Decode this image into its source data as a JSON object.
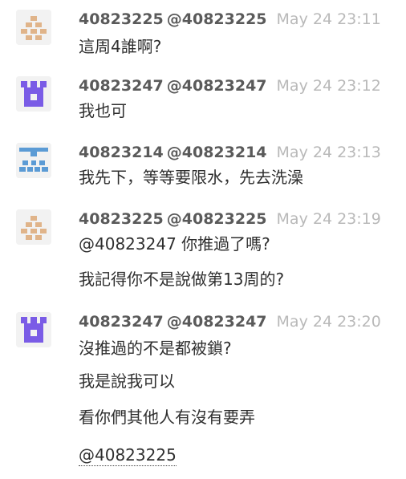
{
  "messages": [
    {
      "user": "40823225",
      "handle": "@40823225",
      "time": "May 24 23:11",
      "avatar_icon": "identicon-orange",
      "avatar_color": "#e0b48a",
      "lines": [
        "這周4誰啊?"
      ]
    },
    {
      "user": "40823247",
      "handle": "@40823247",
      "time": "May 24 23:12",
      "avatar_icon": "identicon-purple",
      "avatar_color": "#7a5ce6",
      "lines": [
        "我也可"
      ]
    },
    {
      "user": "40823214",
      "handle": "@40823214",
      "time": "May 24 23:13",
      "avatar_icon": "identicon-blue",
      "avatar_color": "#5b9bd5",
      "lines": [
        "我先下，等等要限水，先去洗澡"
      ]
    },
    {
      "user": "40823225",
      "handle": "@40823225",
      "time": "May 24 23:19",
      "avatar_icon": "identicon-orange",
      "avatar_color": "#e0b48a",
      "lines": [
        "@40823247 你推過了嗎?",
        "我記得你不是說做第13周的?"
      ]
    },
    {
      "user": "40823247",
      "handle": "@40823247",
      "time": "May 24 23:20",
      "avatar_icon": "identicon-purple",
      "avatar_color": "#7a5ce6",
      "lines": [
        "沒推過的不是都被鎖?",
        "我是說我可以",
        "看你們其他人有沒有要弄",
        "@40823225"
      ]
    }
  ]
}
